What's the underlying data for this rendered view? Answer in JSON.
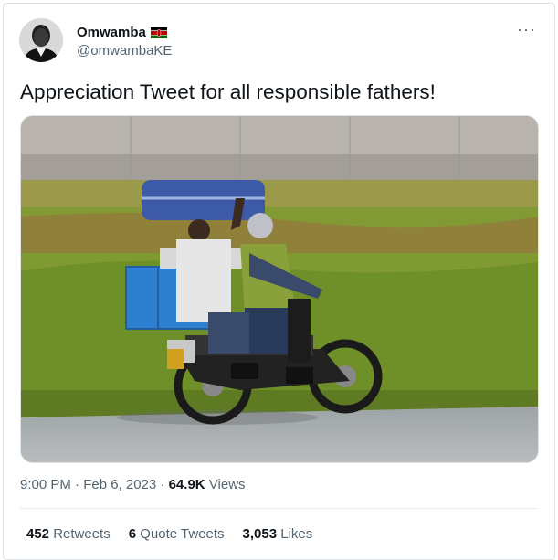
{
  "author": {
    "display_name": "Omwamba",
    "handle": "@omwambaKE",
    "flag_icon": "kenya-flag-icon"
  },
  "more_icon": "more-options-icon",
  "tweet": {
    "text": "Appreciation Tweet for all responsible fathers!"
  },
  "meta": {
    "time_date": "9:00 PM · Feb 6, 2023 · ",
    "views_count": "64.9K",
    "views_label": " Views"
  },
  "stats": {
    "retweets_count": "452",
    "retweets_label": " Retweets",
    "quotes_count": "6",
    "quotes_label": " Quote Tweets",
    "likes_count": "3,053",
    "likes_label": " Likes"
  },
  "colors": {
    "text_primary": "#0f1419",
    "text_secondary": "#536471",
    "border": "#dfe3e6"
  }
}
